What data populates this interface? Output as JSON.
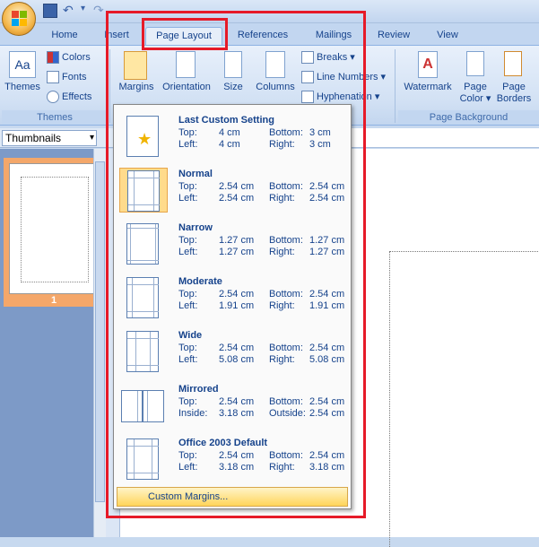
{
  "tabs": [
    "Home",
    "Insert",
    "Page Layout",
    "References",
    "Mailings",
    "Review",
    "View"
  ],
  "ribbon": {
    "themes": {
      "label": "Themes",
      "colors": "Colors",
      "fonts": "Fonts",
      "effects": "Effects",
      "group": "Themes"
    },
    "page_setup": {
      "margins": "Margins",
      "orientation": "Orientation",
      "size": "Size",
      "columns": "Columns",
      "breaks": "Breaks",
      "line_numbers": "Line Numbers",
      "hyphenation": "Hyphenation"
    },
    "page_background": {
      "watermark": "Watermark",
      "page_color": "Page Color",
      "page_color_line1": "Page",
      "page_color_line2": "Color",
      "page_borders_line1": "Page",
      "page_borders_line2": "Borders",
      "group": "Page Background"
    }
  },
  "thumbnails": {
    "selected": "Thumbnails",
    "page_number": "1"
  },
  "margins_menu": {
    "items": [
      {
        "name": "Last Custom Setting",
        "top_label": "Top:",
        "top": "4 cm",
        "bottom_label": "Bottom:",
        "bottom": "3 cm",
        "left_label": "Left:",
        "left": "4 cm",
        "right_label": "Right:",
        "right": "3 cm"
      },
      {
        "name": "Normal",
        "top_label": "Top:",
        "top": "2.54 cm",
        "bottom_label": "Bottom:",
        "bottom": "2.54 cm",
        "left_label": "Left:",
        "left": "2.54 cm",
        "right_label": "Right:",
        "right": "2.54 cm"
      },
      {
        "name": "Narrow",
        "top_label": "Top:",
        "top": "1.27 cm",
        "bottom_label": "Bottom:",
        "bottom": "1.27 cm",
        "left_label": "Left:",
        "left": "1.27 cm",
        "right_label": "Right:",
        "right": "1.27 cm"
      },
      {
        "name": "Moderate",
        "top_label": "Top:",
        "top": "2.54 cm",
        "bottom_label": "Bottom:",
        "bottom": "2.54 cm",
        "left_label": "Left:",
        "left": "1.91 cm",
        "right_label": "Right:",
        "right": "1.91 cm"
      },
      {
        "name": "Wide",
        "top_label": "Top:",
        "top": "2.54 cm",
        "bottom_label": "Bottom:",
        "bottom": "2.54 cm",
        "left_label": "Left:",
        "left": "5.08 cm",
        "right_label": "Right:",
        "right": "5.08 cm"
      },
      {
        "name": "Mirrored",
        "top_label": "Top:",
        "top": "2.54 cm",
        "bottom_label": "Bottom:",
        "bottom": "2.54 cm",
        "left_label": "Inside:",
        "left": "3.18 cm",
        "right_label": "Outside:",
        "right": "2.54 cm"
      },
      {
        "name": "Office 2003 Default",
        "top_label": "Top:",
        "top": "2.54 cm",
        "bottom_label": "Bottom:",
        "bottom": "2.54 cm",
        "left_label": "Left:",
        "left": "3.18 cm",
        "right_label": "Right:",
        "right": "3.18 cm"
      }
    ],
    "custom_label": "Custom Margins..."
  },
  "colors": {
    "highlight": "#e61a28",
    "ribbon_text": "#15428b",
    "selected_item": "#ffdb8c"
  }
}
